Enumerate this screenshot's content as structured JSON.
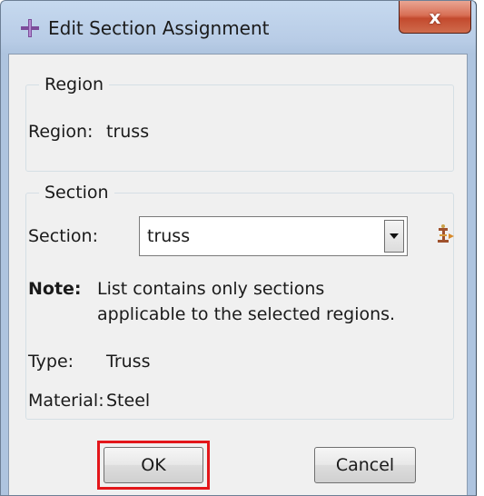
{
  "window": {
    "title": "Edit Section Assignment",
    "icon": "abaqus-plus-icon",
    "close_glyph": "x"
  },
  "region_group": {
    "legend": "Region",
    "region_label": "Region:",
    "region_value": "truss"
  },
  "section_group": {
    "legend": "Section",
    "section_label": "Section:",
    "section_value": "truss",
    "manager_icon": "section-manager-icon",
    "note_label": "Note:",
    "note_line1": "List contains only sections",
    "note_line2": "applicable to the selected regions.",
    "type_label": "Type:",
    "type_value": "Truss",
    "material_label": "Material:",
    "material_value": "Steel"
  },
  "buttons": {
    "ok_label": "OK",
    "cancel_label": "Cancel"
  },
  "colors": {
    "highlight": "#e3161a",
    "close_button": "#c34a2e",
    "title_gradient": "#b8cce6"
  }
}
